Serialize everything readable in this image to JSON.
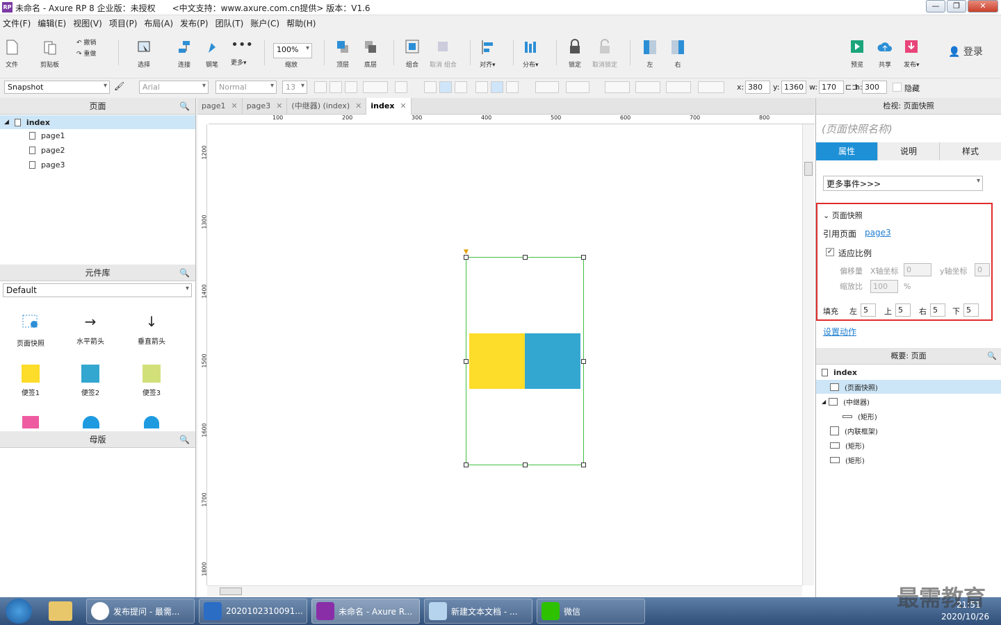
{
  "window": {
    "title": "未命名 - Axure RP 8 企业版：未授权　　<中文支持：www.axure.com.cn提供> 版本：V1.6",
    "logo": "RP"
  },
  "menu": [
    "文件(F)",
    "编辑(E)",
    "视图(V)",
    "项目(P)",
    "布局(A)",
    "发布(P)",
    "团队(T)",
    "账户(C)",
    "帮助(H)"
  ],
  "toolbar": {
    "file": "文件",
    "clipboard": "剪贴板",
    "undo": "撤销",
    "redo": "重做",
    "select": "选择",
    "connect": "连接",
    "pen": "钢笔",
    "more": "更多▾",
    "zoom_value": "100%",
    "zoom_label": "缩放",
    "top": "顶层",
    "bottom": "底层",
    "group": "组合",
    "ungroup": "取消 组合",
    "align": "对齐▾",
    "distribute": "分布▾",
    "lock": "锁定",
    "unlock": "取消锁定",
    "left": "左",
    "right": "右",
    "preview": "预览",
    "share": "共享",
    "publish": "发布▾",
    "login": "登录"
  },
  "format": {
    "style": "Snapshot",
    "font": "Arial",
    "weight": "Normal",
    "size": "13",
    "x_label": "x:",
    "x": "380",
    "y_label": "y:",
    "y": "1360",
    "w_label": "w:",
    "w": "170",
    "h_label": "h:",
    "h": "300",
    "hide": "隐藏"
  },
  "pages_panel": {
    "title": "页面",
    "root": "index",
    "children": [
      "page1",
      "page2",
      "page3"
    ]
  },
  "library_panel": {
    "title": "元件库",
    "selected": "Default",
    "items": [
      {
        "label": "页面快照",
        "icon": "snapshot-icon"
      },
      {
        "label": "水平箭头",
        "icon": "horizontal-arrow-icon"
      },
      {
        "label": "垂直箭头",
        "icon": "vertical-arrow-icon"
      },
      {
        "label": "便签1",
        "color": "#fddc2a"
      },
      {
        "label": "便签2",
        "color": "#34a7d1"
      },
      {
        "label": "便签3",
        "color": "#d2e07a"
      }
    ]
  },
  "masters_panel": {
    "title": "母版"
  },
  "tabs": [
    {
      "label": "page1",
      "close": "✕"
    },
    {
      "label": "page3",
      "close": "✕"
    },
    {
      "label": "(中继器) (index)",
      "close": "✕"
    },
    {
      "label": "index",
      "close": "✕"
    }
  ],
  "ruler_h": [
    "100",
    "200",
    "300",
    "400",
    "500",
    "600",
    "700",
    "800"
  ],
  "ruler_v": [
    "1200",
    "1300",
    "1400",
    "1500",
    "1600",
    "1700",
    "1800"
  ],
  "inspector": {
    "title": "检视: 页面快照",
    "name_placeholder": "(页面快照名称)",
    "tabs": [
      "属性",
      "说明",
      "样式"
    ],
    "more_events": "更多事件>>>",
    "section": "页面快照",
    "ref_label": "引用页面",
    "ref_value": "page3",
    "fit": "适应比例",
    "offset": "偏移量",
    "x_axis": "X轴坐标",
    "x_val": "0",
    "y_axis": "y轴坐标",
    "y_val": "0",
    "scale": "缩放比",
    "scale_val": "100",
    "pct": "%",
    "fill": "填充",
    "left": "左",
    "left_v": "5",
    "top": "上",
    "top_v": "5",
    "right": "右",
    "right_v": "5",
    "bottom": "下",
    "bottom_v": "5",
    "set_action": "设置动作"
  },
  "outline": {
    "title": "概要: 页面",
    "root": "index",
    "items": [
      "(页面快照)",
      "(中继器)",
      "(矩形)",
      "(内联框架)",
      "(矩形)",
      "(矩形)"
    ]
  },
  "taskbar": {
    "tasks": [
      "发布提问 - 最需...",
      "2020102310091...",
      "未命名 - Axure R...",
      "新建文本文档 - ...",
      "微信"
    ],
    "time": "21:51",
    "date": "2020/10/26",
    "watermark": "最需教育"
  }
}
